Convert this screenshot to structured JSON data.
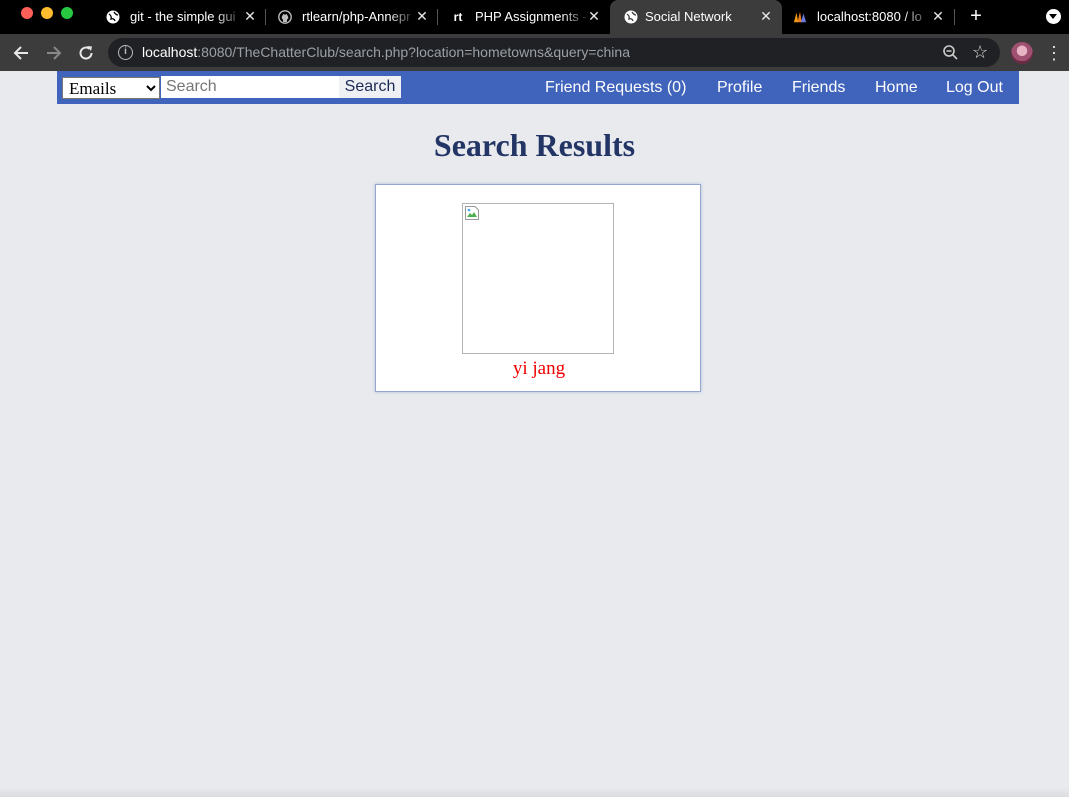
{
  "browser": {
    "tabs": [
      {
        "title": "git - the simple gui",
        "favicon": "globe-icon"
      },
      {
        "title": "rtlearn/php-Annepr",
        "favicon": "github-icon"
      },
      {
        "title": "PHP Assignments -",
        "favicon": "rt",
        "favicon_text": "rt"
      },
      {
        "title": "Social Network",
        "favicon": "globe-icon",
        "active": true
      },
      {
        "title": "localhost:8080 / lo",
        "favicon": "phpmyadmin-icon"
      }
    ],
    "url_host": "localhost",
    "url_rest": ":8080/TheChatterClub/search.php?location=hometowns&query=china"
  },
  "site": {
    "search": {
      "type_selected": "Emails",
      "placeholder": "Search",
      "button_label": "Search"
    },
    "nav": {
      "friend_requests": "Friend Requests (0)",
      "profile": "Profile",
      "friends": "Friends",
      "home": "Home",
      "logout": "Log Out"
    },
    "colors": {
      "navbar": "#4064bb",
      "title": "#233565",
      "result_name": "#ee0000",
      "page_background": "#e8eaee"
    }
  },
  "results": {
    "title": "Search Results",
    "items": [
      {
        "name": "yi jang"
      }
    ]
  }
}
